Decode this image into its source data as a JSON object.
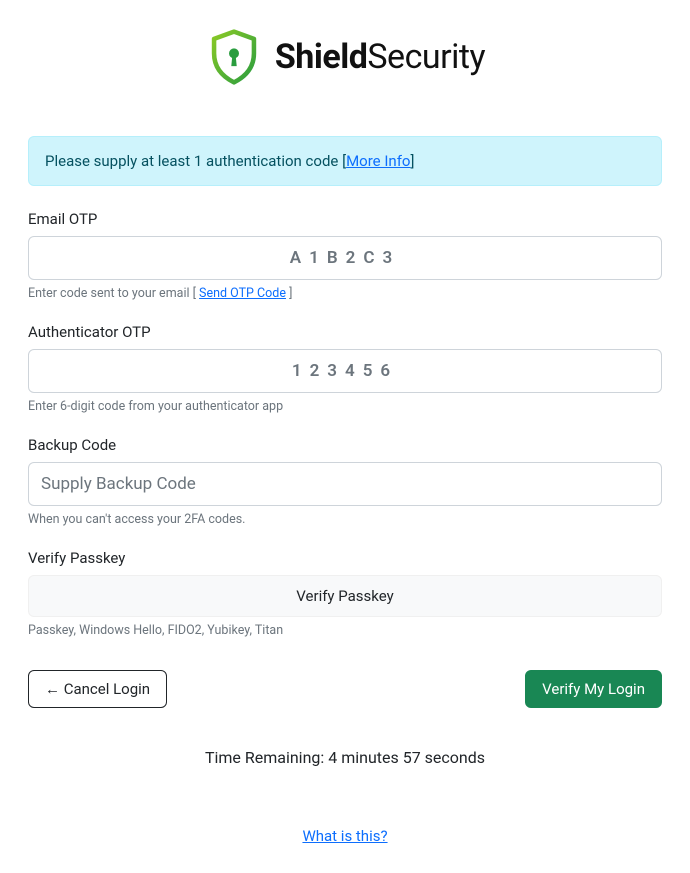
{
  "brand": {
    "name_bold": "Shield",
    "name_light": "Security"
  },
  "alert": {
    "prefix": "Please supply at least 1 authentication code [",
    "link": "More Info",
    "suffix": "]"
  },
  "email_otp": {
    "label": "Email OTP",
    "placeholder": "A1B2C3",
    "help_prefix": "Enter code sent to your email [ ",
    "help_link": "Send OTP Code",
    "help_suffix": " ]"
  },
  "authenticator": {
    "label": "Authenticator OTP",
    "placeholder": "123456",
    "help": "Enter 6-digit code from your authenticator app"
  },
  "backup": {
    "label": "Backup Code",
    "placeholder": "Supply Backup Code",
    "help": "When you can't access your 2FA codes."
  },
  "passkey": {
    "label": "Verify Passkey",
    "button": "Verify Passkey",
    "help": "Passkey, Windows Hello, FIDO2, Yubikey, Titan"
  },
  "actions": {
    "cancel": "← Cancel Login",
    "verify": "Verify My Login"
  },
  "countdown": "Time Remaining: 4 minutes 57 seconds",
  "footer_link": "What is this?"
}
